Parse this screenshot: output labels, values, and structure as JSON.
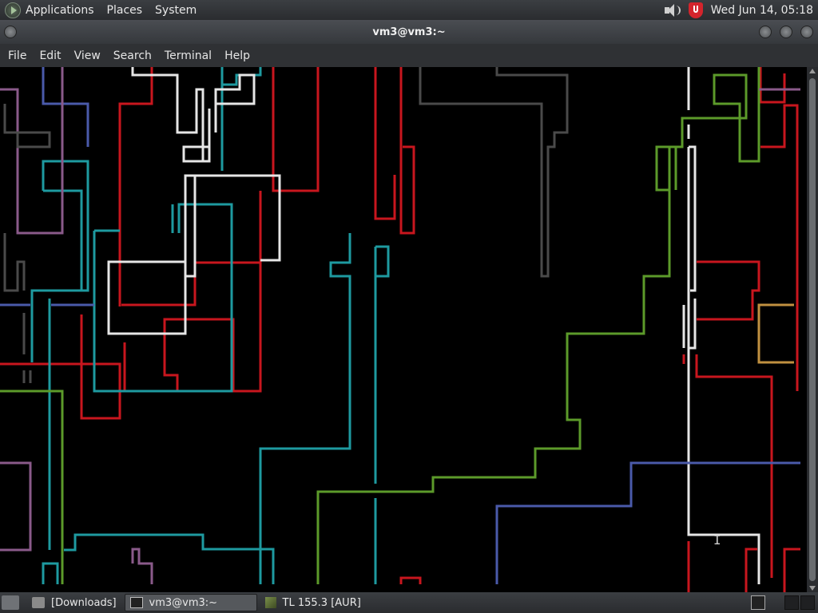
{
  "top_panel": {
    "menus": [
      "Applications",
      "Places",
      "System"
    ],
    "clock": "Wed Jun 14, 05:18"
  },
  "window": {
    "title": "vm3@vm3:~",
    "menubar": [
      "File",
      "Edit",
      "View",
      "Search",
      "Terminal",
      "Help"
    ]
  },
  "taskbar": {
    "tasks": [
      {
        "label": "[Downloads]",
        "icon": "folder-icon",
        "active": false
      },
      {
        "label": "vm3@vm3:~",
        "icon": "terminal-icon",
        "active": true
      },
      {
        "label": "TL 155.3 [AUR]",
        "icon": "cube-icon",
        "active": false
      }
    ]
  },
  "colors": {
    "red": "#c8161e",
    "cyan": "#1e9aa0",
    "white": "#e6e6e6",
    "green": "#5c9a2a",
    "blue": "#4a5aaa",
    "purple": "#8a5a8a",
    "gray": "#4a4a4a",
    "orange": "#c09040"
  }
}
